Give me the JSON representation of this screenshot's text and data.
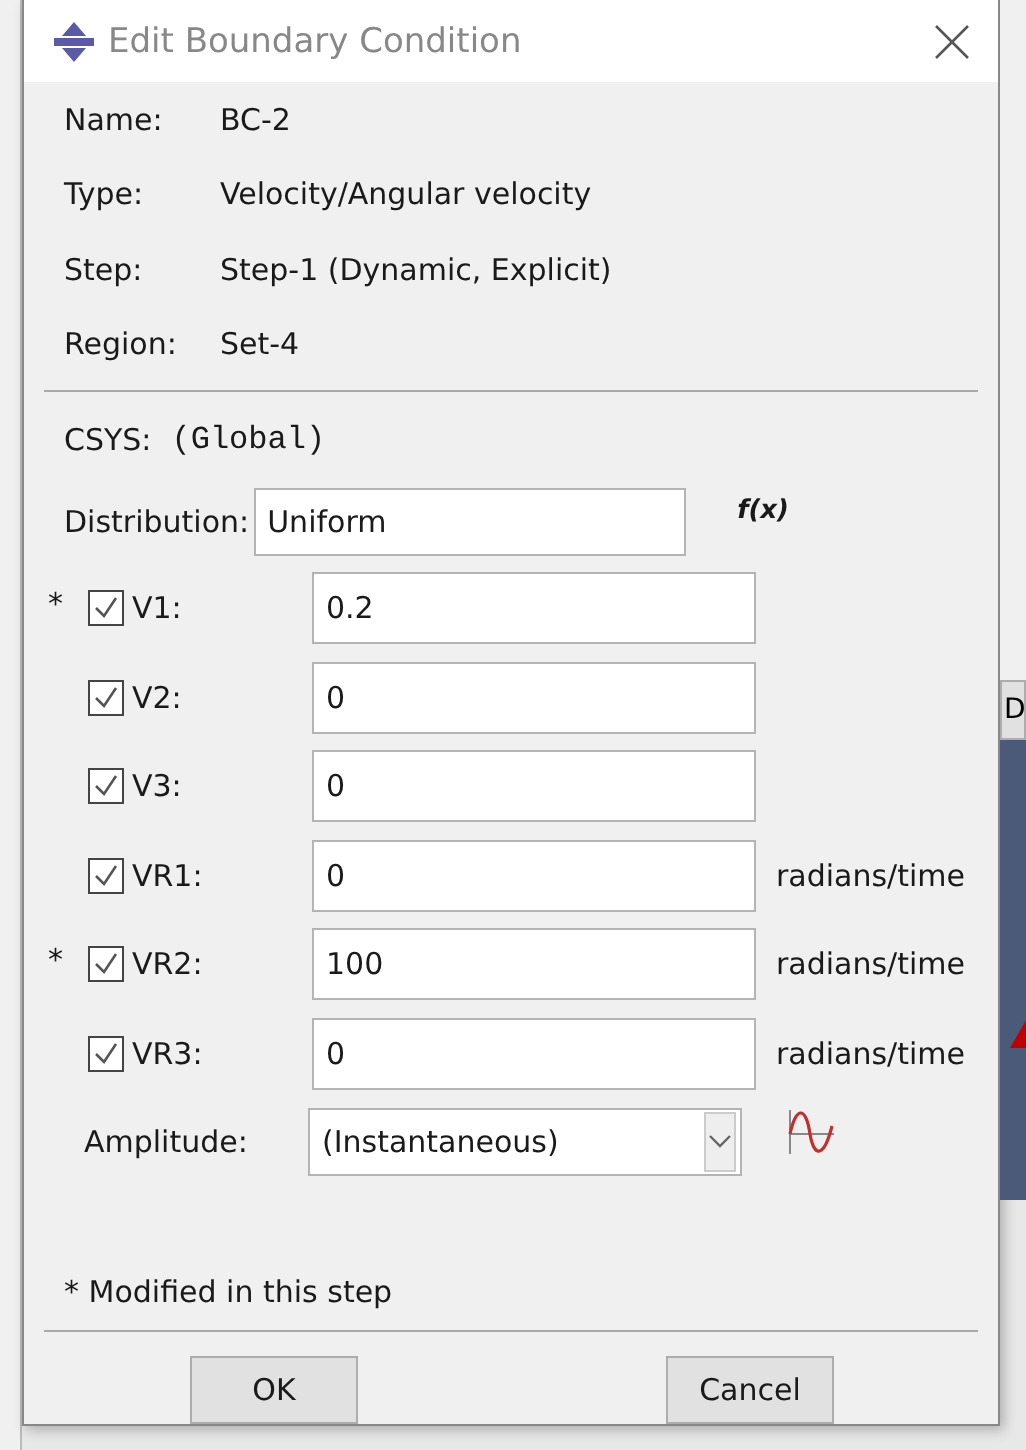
{
  "window": {
    "title": "Edit Boundary Condition"
  },
  "info": [
    {
      "label": "Name:",
      "value": "BC-2"
    },
    {
      "label": "Type:",
      "value": "Velocity/Angular velocity"
    },
    {
      "label": "Step:",
      "value": "Step-1 (Dynamic, Explicit)"
    },
    {
      "label": "Region:",
      "value": "Set-4"
    }
  ],
  "csys": {
    "label": "CSYS:",
    "value": "(Global)"
  },
  "distribution": {
    "label": "Distribution:",
    "value": "Uniform",
    "function_button": "f(x)"
  },
  "components": [
    {
      "marker": "*",
      "label": "V1:",
      "checked": true,
      "value": "0.2"
    },
    {
      "label": "V2:",
      "checked": true,
      "value": "0"
    },
    {
      "label": "V3:",
      "checked": true,
      "value": "0"
    },
    {
      "label": "VR1:",
      "checked": true,
      "value": "0",
      "unit": "radians/time"
    },
    {
      "marker": "*",
      "label": "VR2:",
      "checked": true,
      "value": "100",
      "unit": "radians/time"
    },
    {
      "label": "VR3:",
      "checked": true,
      "value": "0",
      "unit": "radians/time"
    }
  ],
  "amplitude": {
    "label": "Amplitude:",
    "value": "(Instantaneous)"
  },
  "note": "* Modified in this step",
  "buttons": [
    "OK",
    "Cancel"
  ],
  "background": {
    "button_fragment": "D"
  }
}
